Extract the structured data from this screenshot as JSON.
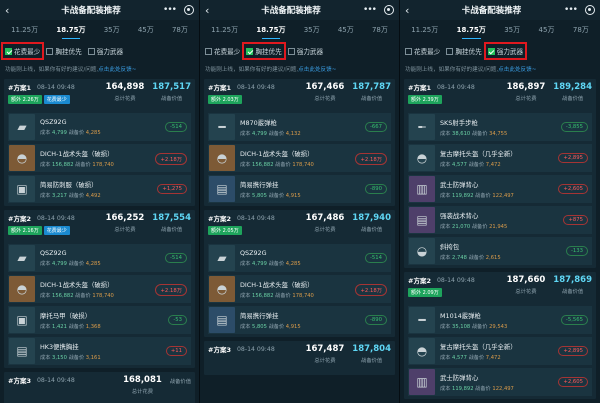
{
  "app": {
    "title": "卡战备配装推荐",
    "back_icon": "back-arrow-icon",
    "more_icon": "more-dots-icon",
    "target_icon": "target-icon"
  },
  "tabs": [
    "11.25万",
    "18.75万",
    "35万",
    "45万",
    "78万"
  ],
  "filters": [
    "花费最少",
    "胸挂优先",
    "强力武器"
  ],
  "info": {
    "text": "功能刚上线，如果你有好的建议/问题,",
    "link": "点击此处反馈~"
  },
  "labels": {
    "total_cost": "总计花费",
    "total_value": "战备价值",
    "cost_prefix": "成本",
    "value_prefix": "战备价"
  },
  "colors": {
    "accent": "#2fb6ff",
    "checked": "#23c15b",
    "highlight": "#e0191f",
    "positive": "#37c06f",
    "negative": "#ff5a5a"
  },
  "panels": [
    {
      "active_tab": 1,
      "checked": 0,
      "plans": [
        {
          "name": "#方案1",
          "date": "08-14 09:48",
          "badges": [
            {
              "text": "额外 2.26万",
              "color": "green"
            },
            {
              "text": "花费最少",
              "color": "blue"
            }
          ],
          "total_cost": "164,898",
          "total_value": "187,517",
          "items": [
            {
              "name": "QSZ92G",
              "cost": "4,799",
              "value": "4,285",
              "diff": "-514",
              "diff_type": "green",
              "thumb": "pistol-icon",
              "tone": "default"
            },
            {
              "name": "DICH-1战术头盔（破损）",
              "cost": "156,882",
              "value": "178,740",
              "diff": "+2.18万",
              "diff_type": "red",
              "thumb": "helmet-icon",
              "tone": "orange"
            },
            {
              "name": "简易防刺服（破损）",
              "cost": "3,217",
              "value": "4,492",
              "diff": "+1,275",
              "diff_type": "red",
              "thumb": "vest-icon",
              "tone": "default"
            }
          ]
        },
        {
          "name": "#方案2",
          "date": "08-14 09:48",
          "badges": [
            {
              "text": "额外 2.16万",
              "color": "green"
            },
            {
              "text": "花费最少",
              "color": "blue"
            }
          ],
          "total_cost": "166,252",
          "total_value": "187,554",
          "items": [
            {
              "name": "QSZ92G",
              "cost": "4,799",
              "value": "4,285",
              "diff": "-514",
              "diff_type": "green",
              "thumb": "pistol-icon",
              "tone": "default"
            },
            {
              "name": "DICH-1战术头盔（破损）",
              "cost": "156,882",
              "value": "178,740",
              "diff": "+2.18万",
              "diff_type": "red",
              "thumb": "helmet-icon",
              "tone": "orange"
            },
            {
              "name": "摩托马甲（破损）",
              "cost": "1,421",
              "value": "1,368",
              "diff": "-53",
              "diff_type": "green",
              "thumb": "vest-icon",
              "tone": "default"
            },
            {
              "name": "HK3便携胸挂",
              "cost": "3,150",
              "value": "3,161",
              "diff": "+11",
              "diff_type": "red",
              "thumb": "chest-rig-icon",
              "tone": "default"
            }
          ]
        },
        {
          "name": "#方案3",
          "date": "08-14 09:48",
          "badges": [],
          "total_cost": "168,081",
          "total_value": "",
          "items": []
        }
      ]
    },
    {
      "active_tab": 1,
      "checked": 1,
      "plans": [
        {
          "name": "#方案1",
          "date": "08-14 09:48",
          "badges": [
            {
              "text": "额外 2.03万",
              "color": "green"
            }
          ],
          "total_cost": "167,466",
          "total_value": "187,787",
          "items": [
            {
              "name": "M870霰弹枪",
              "cost": "4,799",
              "value": "4,132",
              "diff": "-667",
              "diff_type": "green",
              "thumb": "shotgun-icon",
              "tone": "default"
            },
            {
              "name": "DICH-1战术头盔（破损）",
              "cost": "156,882",
              "value": "178,740",
              "diff": "+2.18万",
              "diff_type": "red",
              "thumb": "helmet-icon",
              "tone": "orange"
            },
            {
              "name": "简易携行弹挂",
              "cost": "5,805",
              "value": "4,915",
              "diff": "-890",
              "diff_type": "green",
              "thumb": "chest-rig-icon",
              "tone": "blue"
            }
          ]
        },
        {
          "name": "#方案2",
          "date": "08-14 09:48",
          "badges": [
            {
              "text": "额外 2.05万",
              "color": "green"
            }
          ],
          "total_cost": "167,486",
          "total_value": "187,940",
          "items": [
            {
              "name": "QSZ92G",
              "cost": "4,799",
              "value": "4,285",
              "diff": "-514",
              "diff_type": "green",
              "thumb": "pistol-icon",
              "tone": "default"
            },
            {
              "name": "DICH-1战术头盔（破损）",
              "cost": "156,882",
              "value": "178,740",
              "diff": "+2.18万",
              "diff_type": "red",
              "thumb": "helmet-icon",
              "tone": "orange"
            },
            {
              "name": "简易携行弹挂",
              "cost": "5,805",
              "value": "4,915",
              "diff": "-890",
              "diff_type": "green",
              "thumb": "chest-rig-icon",
              "tone": "blue"
            }
          ]
        },
        {
          "name": "#方案3",
          "date": "08-14 09:48",
          "badges": [],
          "total_cost": "167,487",
          "total_value": "187,804",
          "items": []
        }
      ]
    },
    {
      "active_tab": 1,
      "checked": 2,
      "plans": [
        {
          "name": "#方案1",
          "date": "08-14 09:48",
          "badges": [
            {
              "text": "额外 2.39万",
              "color": "green"
            }
          ],
          "total_cost": "186,897",
          "total_value": "189,284",
          "items": [
            {
              "name": "SKS射手步枪",
              "cost": "38,610",
              "value": "34,755",
              "diff": "-3,855",
              "diff_type": "green",
              "thumb": "rifle-icon",
              "tone": "default"
            },
            {
              "name": "复古摩托头盔（几乎全新）",
              "cost": "4,577",
              "value": "7,472",
              "diff": "+2,895",
              "diff_type": "red",
              "thumb": "helmet-icon",
              "tone": "default"
            },
            {
              "name": "武士防弹背心",
              "cost": "119,892",
              "value": "122,497",
              "diff": "+2,605",
              "diff_type": "red",
              "thumb": "armor-vest-icon",
              "tone": "purple"
            },
            {
              "name": "强袭战术背心",
              "cost": "21,070",
              "value": "21,945",
              "diff": "+875",
              "diff_type": "red",
              "thumb": "chest-rig-icon",
              "tone": "purple"
            },
            {
              "name": "斜挎包",
              "cost": "2,748",
              "value": "2,615",
              "diff": "-133",
              "diff_type": "green",
              "thumb": "bag-icon",
              "tone": "default"
            }
          ]
        },
        {
          "name": "#方案2",
          "date": "08-14 09:48",
          "badges": [
            {
              "text": "额外 2.09万",
              "color": "green"
            }
          ],
          "total_cost": "187,660",
          "total_value": "187,869",
          "items": [
            {
              "name": "M1014霰弹枪",
              "cost": "35,108",
              "value": "29,543",
              "diff": "-5,565",
              "diff_type": "green",
              "thumb": "shotgun-icon",
              "tone": "default"
            },
            {
              "name": "复古摩托头盔（几乎全新）",
              "cost": "4,577",
              "value": "7,472",
              "diff": "+2,895",
              "diff_type": "red",
              "thumb": "helmet-icon",
              "tone": "default"
            },
            {
              "name": "武士防弹背心",
              "cost": "119,892",
              "value": "122,497",
              "diff": "+2,605",
              "diff_type": "red",
              "thumb": "armor-vest-icon",
              "tone": "purple"
            }
          ]
        }
      ]
    }
  ]
}
